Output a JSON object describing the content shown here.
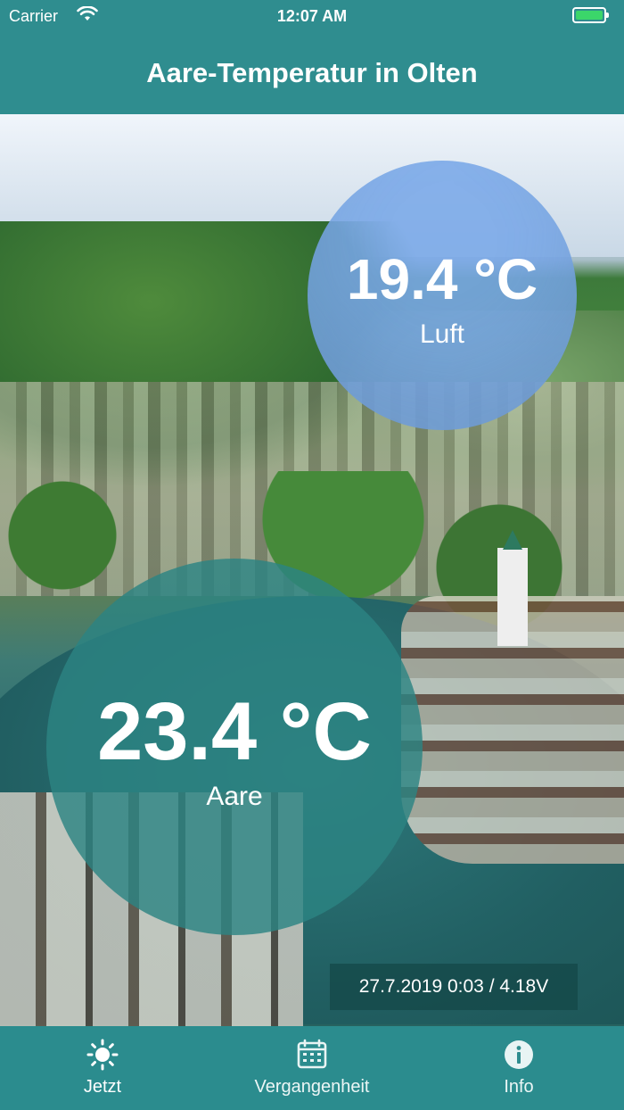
{
  "status_bar": {
    "carrier": "Carrier",
    "time": "12:07 AM"
  },
  "nav": {
    "title": "Aare-Temperatur in Olten"
  },
  "air": {
    "value": "19.4 °C",
    "label": "Luft"
  },
  "aare": {
    "value": "23.4 °C",
    "label": "Aare"
  },
  "timestamp": "27.7.2019 0:03 / 4.18V",
  "tabs": [
    {
      "label": "Jetzt",
      "icon": "sun-icon",
      "active": true
    },
    {
      "label": "Vergangenheit",
      "icon": "calendar-icon",
      "active": false
    },
    {
      "label": "Info",
      "icon": "info-icon",
      "active": false
    }
  ],
  "colors": {
    "bar": "#2f8d8f",
    "air_bubble": "#7aa8e8",
    "aare_bubble": "#2c8483",
    "battery": "#3bd66a"
  }
}
